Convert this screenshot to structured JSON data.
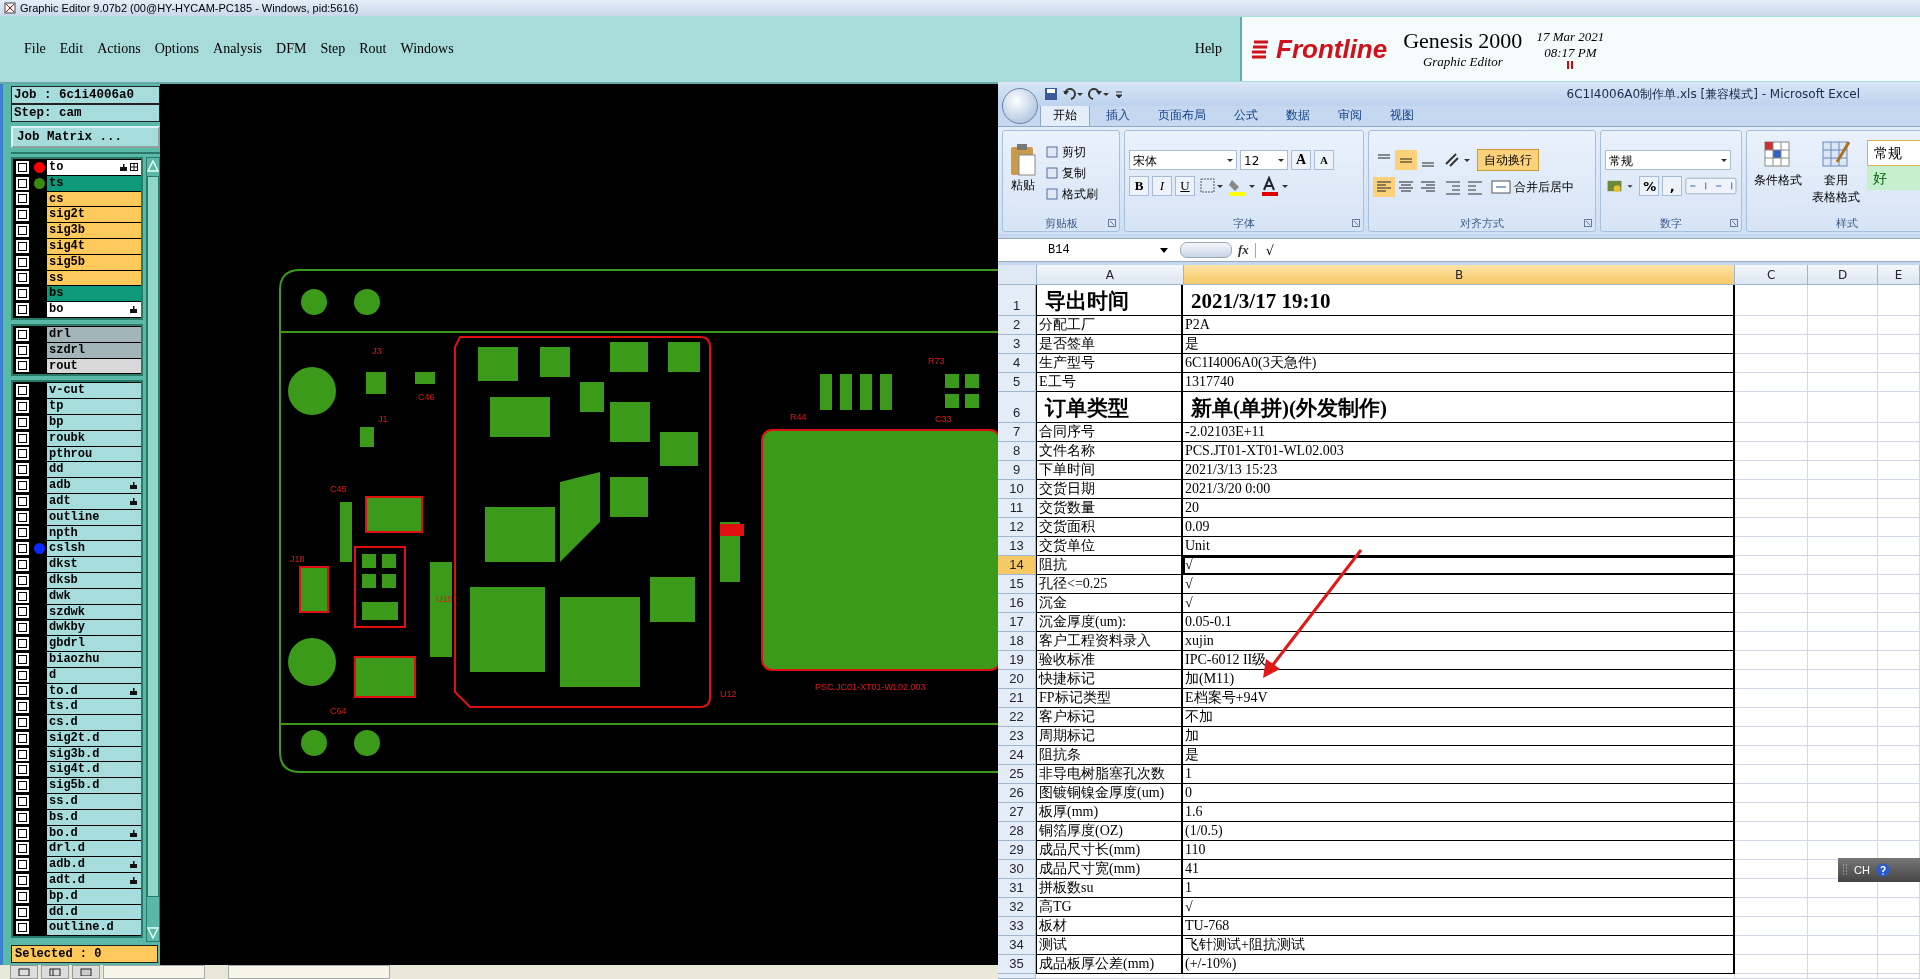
{
  "app_title": "Graphic Editor 9.07b2 (00@HY-HYCAM-PC185 - Windows, pid:5616)",
  "menu": [
    "File",
    "Edit",
    "Actions",
    "Options",
    "Analysis",
    "DFM",
    "Step",
    "Rout",
    "Windows"
  ],
  "help": "Help",
  "brand": {
    "logo": "Frontline",
    "product": "Genesis 2000",
    "subtitle": "Graphic Editor",
    "date": "17 Mar 2021",
    "time": "08:17 PM"
  },
  "job": "Job : 6c1i4006a0",
  "step": "Step: cam",
  "job_matrix_button": "Job Matrix ...",
  "layer_groups": [
    [
      {
        "name": "to",
        "color": "#ffffff",
        "checked": false,
        "dot": {
          "color": "#ff0000"
        },
        "hand": true,
        "grid": true
      },
      {
        "name": "ts",
        "color": "#0e9a7a",
        "checked": false,
        "dot": {
          "color": "#3a8a10"
        },
        "hand": false,
        "grid": false
      },
      {
        "name": "cs",
        "color": "#ffc85a",
        "checked": false,
        "hand": false,
        "grid": false
      },
      {
        "name": "sig2t",
        "color": "#ffc85a",
        "checked": false,
        "hand": false,
        "grid": false
      },
      {
        "name": "sig3b",
        "color": "#ffc85a",
        "checked": false,
        "hand": false,
        "grid": false
      },
      {
        "name": "sig4t",
        "color": "#ffc85a",
        "checked": false,
        "hand": false,
        "grid": false
      },
      {
        "name": "sig5b",
        "color": "#ffc85a",
        "checked": false,
        "hand": false,
        "grid": false
      },
      {
        "name": "ss",
        "color": "#ffc85a",
        "checked": false,
        "hand": false,
        "grid": false
      },
      {
        "name": "bs",
        "color": "#0e9a7a",
        "checked": false,
        "hand": false,
        "grid": false
      },
      {
        "name": "bo",
        "color": "#ffffff",
        "checked": false,
        "hand": true,
        "grid": false
      }
    ],
    [
      {
        "name": "drl",
        "color": "#a3b5b9",
        "checked": false,
        "hand": false,
        "grid": false
      },
      {
        "name": "szdrl",
        "color": "#a3b5b9",
        "checked": false,
        "hand": false,
        "grid": false
      },
      {
        "name": "rout",
        "color": "#d8d8d8",
        "checked": false,
        "hand": false,
        "grid": false
      }
    ],
    [
      {
        "name": "v-cut",
        "color": "#a6dcdc",
        "checked": false,
        "hand": false,
        "grid": false
      },
      {
        "name": "tp",
        "color": "#a6dcdc",
        "checked": false,
        "hand": false,
        "grid": false
      },
      {
        "name": "bp",
        "color": "#a6dcdc",
        "checked": false,
        "hand": false,
        "grid": false
      },
      {
        "name": "roubk",
        "color": "#a6dcdc",
        "checked": false,
        "hand": false,
        "grid": false
      },
      {
        "name": "pthrou",
        "color": "#a6dcdc",
        "checked": false,
        "hand": false,
        "grid": false
      },
      {
        "name": "dd",
        "color": "#a6dcdc",
        "checked": false,
        "hand": false,
        "grid": false
      },
      {
        "name": "adb",
        "color": "#a6dcdc",
        "checked": false,
        "hand": true,
        "grid": false
      },
      {
        "name": "adt",
        "color": "#a6dcdc",
        "checked": false,
        "hand": true,
        "grid": false
      },
      {
        "name": "outline",
        "color": "#a6dcdc",
        "checked": false,
        "hand": false,
        "grid": false
      },
      {
        "name": "npth",
        "color": "#a6dcdc",
        "checked": false,
        "hand": false,
        "grid": false
      },
      {
        "name": "cslsh",
        "color": "#a6dcdc",
        "checked": false,
        "dot": {
          "color": "#0a28ff"
        },
        "hand": false,
        "grid": false
      },
      {
        "name": "dkst",
        "color": "#a6dcdc",
        "checked": false,
        "hand": false,
        "grid": false
      },
      {
        "name": "dksb",
        "color": "#a6dcdc",
        "checked": false,
        "hand": false,
        "grid": false
      },
      {
        "name": "dwk",
        "color": "#a6dcdc",
        "checked": false,
        "hand": false,
        "grid": false
      },
      {
        "name": "szdwk",
        "color": "#a6dcdc",
        "checked": false,
        "hand": false,
        "grid": false
      },
      {
        "name": "dwkby",
        "color": "#a6dcdc",
        "checked": false,
        "hand": false,
        "grid": false
      },
      {
        "name": "gbdrl",
        "color": "#a6dcdc",
        "checked": false,
        "hand": false,
        "grid": false
      },
      {
        "name": "biaozhu",
        "color": "#a6dcdc",
        "checked": false,
        "hand": false,
        "grid": false
      },
      {
        "name": "d",
        "color": "#a6dcdc",
        "checked": false,
        "hand": false,
        "grid": false
      },
      {
        "name": "to.d",
        "color": "#a6dcdc",
        "checked": false,
        "hand": true,
        "grid": false
      },
      {
        "name": "ts.d",
        "color": "#a6dcdc",
        "checked": false,
        "hand": false,
        "grid": false
      },
      {
        "name": "cs.d",
        "color": "#a6dcdc",
        "checked": false,
        "hand": false,
        "grid": false
      },
      {
        "name": "sig2t.d",
        "color": "#a6dcdc",
        "checked": false,
        "hand": false,
        "grid": false
      },
      {
        "name": "sig3b.d",
        "color": "#a6dcdc",
        "checked": false,
        "hand": false,
        "grid": false
      },
      {
        "name": "sig4t.d",
        "color": "#a6dcdc",
        "checked": false,
        "hand": false,
        "grid": false
      },
      {
        "name": "sig5b.d",
        "color": "#a6dcdc",
        "checked": false,
        "hand": false,
        "grid": false
      },
      {
        "name": "ss.d",
        "color": "#a6dcdc",
        "checked": false,
        "hand": false,
        "grid": false
      },
      {
        "name": "bs.d",
        "color": "#a6dcdc",
        "checked": false,
        "hand": false,
        "grid": false
      },
      {
        "name": "bo.d",
        "color": "#a6dcdc",
        "checked": false,
        "hand": true,
        "grid": false
      },
      {
        "name": "drl.d",
        "color": "#a6dcdc",
        "checked": false,
        "hand": false,
        "grid": false
      },
      {
        "name": "adb.d",
        "color": "#a6dcdc",
        "checked": false,
        "hand": true,
        "grid": false
      },
      {
        "name": "adt.d",
        "color": "#a6dcdc",
        "checked": false,
        "hand": true,
        "grid": false
      },
      {
        "name": "bp.d",
        "color": "#a6dcdc",
        "checked": false,
        "hand": false,
        "grid": false
      },
      {
        "name": "dd.d",
        "color": "#a6dcdc",
        "checked": false,
        "hand": false,
        "grid": false
      },
      {
        "name": "outline.d",
        "color": "#a6dcdc",
        "checked": false,
        "hand": false,
        "grid": false
      }
    ]
  ],
  "selected_status": "Selected : 0",
  "pcb_labels": [
    "J3",
    "C46",
    "J1",
    "C45",
    "J18",
    "C64",
    "U10",
    "U12",
    "R44",
    "R73",
    "C33",
    "PSC.JC01-XT01-WL02.003"
  ],
  "excel": {
    "title": "6C1I4006A0制作单.xls  [兼容模式] - Microsoft Excel",
    "tabs": [
      {
        "label": "开始",
        "selected": true
      },
      {
        "label": "插入",
        "selected": false
      },
      {
        "label": "页面布局",
        "selected": false
      },
      {
        "label": "公式",
        "selected": false
      },
      {
        "label": "数据",
        "selected": false
      },
      {
        "label": "审阅",
        "selected": false
      },
      {
        "label": "视图",
        "selected": false
      }
    ],
    "ribbon_groups": [
      {
        "kind": "clipboard",
        "label": "剪贴板",
        "paste": "粘贴",
        "items": [
          "剪切",
          "复制",
          "格式刷"
        ]
      },
      {
        "kind": "font",
        "label": "字体",
        "font": "宋体",
        "size": "12",
        "grow_shrink": [
          "A",
          "A"
        ],
        "styles": [
          "B",
          "I",
          "U"
        ]
      },
      {
        "kind": "alignment",
        "label": "对齐方式",
        "vertical_align": [
          {
            "selected": false
          },
          {
            "selected": true
          },
          {
            "selected": false
          }
        ],
        "horizontal_align": [
          {
            "selected": true
          },
          {
            "selected": false
          },
          {
            "selected": false
          }
        ],
        "wrap": {
          "label": "自动换行",
          "on": true
        },
        "merge": "合并后居中"
      },
      {
        "kind": "number",
        "label": "数字",
        "format": "常规",
        "symbols": [
          "%",
          ","
        ]
      },
      {
        "kind": "styles",
        "label": "样式",
        "conditional": "条件格式",
        "table_format": [
          "套用",
          "表格格式"
        ],
        "cell_styles": [
          "常规",
          "好"
        ]
      }
    ],
    "name_box": "B14",
    "function_label": "fx",
    "formula": "√",
    "columns": [
      {
        "label": "A",
        "selected": false
      },
      {
        "label": "B",
        "selected": true
      },
      {
        "label": "C",
        "selected": false
      },
      {
        "label": "D",
        "selected": false
      },
      {
        "label": "E",
        "selected": false
      }
    ],
    "rows": [
      {
        "n": "1",
        "a": "导出时间",
        "b": "2021/3/17  19:10",
        "kind": "heading",
        "selected": false
      },
      {
        "n": "2",
        "a": "分配工厂",
        "b": "P2A",
        "kind": "normal",
        "selected": false
      },
      {
        "n": "3",
        "a": "是否签单",
        "b": "是",
        "kind": "normal",
        "selected": false
      },
      {
        "n": "4",
        "a": "生产型号",
        "b": "6C1I4006A0(3天急件)",
        "kind": "normal",
        "selected": false
      },
      {
        "n": "5",
        "a": "E工号",
        "b": "1317740",
        "kind": "normal",
        "selected": false
      },
      {
        "n": "6",
        "a": "订单类型",
        "b": "新单(单拼)(外发制作)",
        "kind": "heading",
        "selected": false
      },
      {
        "n": "7",
        "a": "合同序号",
        "b": "-2.02103E+11",
        "kind": "normal",
        "selected": false
      },
      {
        "n": "8",
        "a": "文件名称",
        "b": "PCS.JT01-XT01-WL02.003",
        "kind": "normal",
        "selected": false
      },
      {
        "n": "9",
        "a": "下单时间",
        "b": "2021/3/13 15:23",
        "kind": "normal",
        "selected": false
      },
      {
        "n": "10",
        "a": "交货日期",
        "b": "2021/3/20 0:00",
        "kind": "normal",
        "selected": false
      },
      {
        "n": "11",
        "a": "交货数量",
        "b": "20",
        "kind": "normal",
        "selected": false
      },
      {
        "n": "12",
        "a": "交货面积",
        "b": "0.09",
        "kind": "normal",
        "selected": false
      },
      {
        "n": "13",
        "a": "交货单位",
        "b": "Unit",
        "kind": "normal",
        "selected": false
      },
      {
        "n": "14",
        "a": "阻抗",
        "b": "√",
        "kind": "normal",
        "selected": true
      },
      {
        "n": "15",
        "a": "孔径<=0.25",
        "b": "√",
        "kind": "normal",
        "selected": false
      },
      {
        "n": "16",
        "a": "沉金",
        "b": "√",
        "kind": "normal",
        "selected": false
      },
      {
        "n": "17",
        "a": "沉金厚度(um):",
        "b": "0.05-0.1",
        "kind": "normal",
        "selected": false
      },
      {
        "n": "18",
        "a": "客户工程资料录入",
        "b": "xujin",
        "kind": "normal",
        "selected": false
      },
      {
        "n": "19",
        "a": "验收标准",
        "b": "IPC-6012 II级",
        "kind": "normal",
        "selected": false
      },
      {
        "n": "20",
        "a": "快捷标记",
        "b": "加(M11)",
        "kind": "normal",
        "selected": false
      },
      {
        "n": "21",
        "a": "FP标记类型",
        "b": "E档案号+94V",
        "kind": "normal",
        "selected": false
      },
      {
        "n": "22",
        "a": "客户标记",
        "b": "不加",
        "kind": "normal",
        "selected": false
      },
      {
        "n": "23",
        "a": "周期标记",
        "b": "加",
        "kind": "normal",
        "selected": false
      },
      {
        "n": "24",
        "a": "阻抗条",
        "b": "是",
        "kind": "normal",
        "selected": false
      },
      {
        "n": "25",
        "a": "非导电树脂塞孔次数",
        "b": "1",
        "kind": "normal",
        "selected": false
      },
      {
        "n": "26",
        "a": "图镀铜镍金厚度(um)",
        "b": "0",
        "kind": "normal",
        "selected": false
      },
      {
        "n": "27",
        "a": "板厚(mm)",
        "b": "1.6",
        "kind": "normal",
        "selected": false
      },
      {
        "n": "28",
        "a": "铜箔厚度(OZ)",
        "b": "(1/0.5)",
        "kind": "normal",
        "selected": false
      },
      {
        "n": "29",
        "a": "成品尺寸长(mm)",
        "b": "110",
        "kind": "normal",
        "selected": false
      },
      {
        "n": "30",
        "a": "成品尺寸宽(mm)",
        "b": "41",
        "kind": "normal",
        "selected": false
      },
      {
        "n": "31",
        "a": "拼板数su",
        "b": "1",
        "kind": "normal",
        "selected": false
      },
      {
        "n": "32",
        "a": "高TG",
        "b": "√",
        "kind": "normal",
        "selected": false
      },
      {
        "n": "33",
        "a": "板材",
        "b": "TU-768",
        "kind": "normal",
        "selected": false
      },
      {
        "n": "34",
        "a": "测试",
        "b": "飞针测试+阻抗测试",
        "kind": "normal",
        "selected": false
      },
      {
        "n": "35",
        "a": "成品板厚公差(mm)",
        "b": "(+/-10%)",
        "kind": "normal",
        "selected": false
      }
    ]
  },
  "ime": {
    "label": "CH"
  }
}
